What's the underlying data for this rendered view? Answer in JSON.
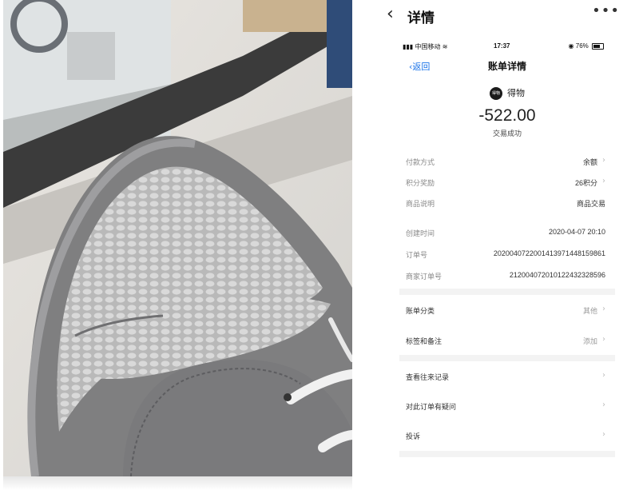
{
  "outer": {
    "back_icon": "chevron-left-icon",
    "title": "详情",
    "more_icon": "more-icon"
  },
  "status_bar": {
    "carrier": "中国移动",
    "time": "17:37",
    "battery": "76%"
  },
  "nav": {
    "back_label": "返回",
    "title": "账单详情"
  },
  "merchant": {
    "logo_text": "得物",
    "name": "得物"
  },
  "amount": "-522.00",
  "status": "交易成功",
  "details": [
    {
      "label": "付款方式",
      "value": "余额",
      "has_arrow": true
    },
    {
      "label": "积分奖励",
      "value": "26积分",
      "has_arrow": true
    },
    {
      "label": "商品说明",
      "value": "商品交易",
      "has_arrow": false
    }
  ],
  "order_info": [
    {
      "label": "创建时间",
      "value": "2020-04-07 20:10"
    },
    {
      "label": "订单号",
      "value": "20200407220014139714481598​61"
    },
    {
      "label": "商家订单号",
      "value": "21200407201012243232859​6"
    }
  ],
  "category": [
    {
      "label": "账单分类",
      "value": "其他"
    },
    {
      "label": "标签和备注",
      "value": "添加"
    }
  ],
  "links": [
    {
      "label": "查看往来记录"
    },
    {
      "label": "对此订单有疑问"
    },
    {
      "label": "投诉"
    }
  ],
  "colors": {
    "accent": "#1a73e8",
    "separator": "#f3f3f3",
    "label_gray": "#8a8a8a"
  }
}
